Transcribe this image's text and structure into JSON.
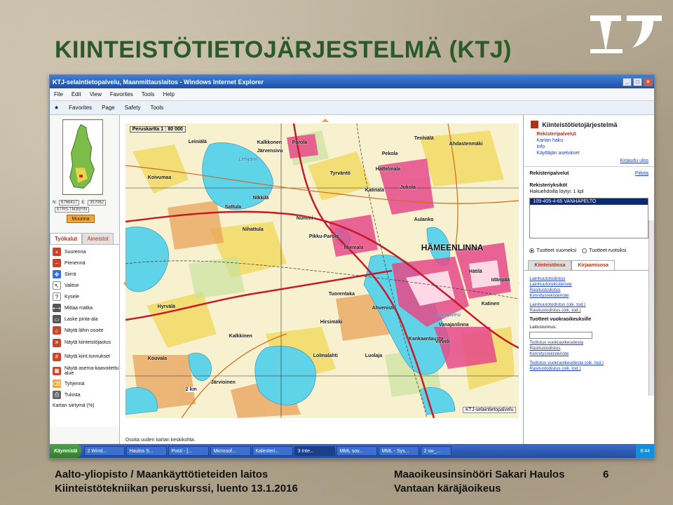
{
  "slide": {
    "title": "KIINTEISTÖTIETOJÄRJESTELMÄ (KTJ)",
    "footer_left_1": "Aalto-yliopisto / Maankäyttötieteiden laitos",
    "footer_left_2": "Kiinteistötekniikan peruskurssi, luento 13.1.2016",
    "footer_right_1": "Maaoikeusinsinööri Sakari Haulos",
    "footer_right_2": "Vantaan käräjäoikeus",
    "page_number": "6"
  },
  "browser": {
    "title": "KTJ-selaintietopalvelu, Maanmittauslaitos - Windows Internet Explorer",
    "menu": [
      "File",
      "Edit",
      "View",
      "Favorites",
      "Tools",
      "Help"
    ],
    "commands": [
      "Favorites",
      "Page",
      "Safety",
      "Tools"
    ]
  },
  "left_panel": {
    "n_label": "N:",
    "n_value": "6766417",
    "e_label": "E:",
    "e_value": "357062",
    "crs": "ETRS-TM35FIN",
    "convert_button": "Muunna",
    "tab_tools": "Työkalut",
    "tab_materials": "Aineistot",
    "tools": [
      "Suurenna",
      "Pienennä",
      "Siirrä",
      "Valitse",
      "Kysele",
      "Mittaa matka",
      "Laske pinta-ala",
      "Näytä lähin osoite",
      "Näytä kiinteistöjaotus",
      "Näytä kiint.tunnukset",
      "Näytä asema-kaavoitettu alue",
      "Tyhjennä",
      "Tulosta"
    ],
    "map_move": "Kartan siirtymä (%)"
  },
  "map": {
    "scale": "Peruskartta 1 : 80 000",
    "status": "Osoita uuden kartan keskikohta.",
    "ktj_label": "KTJ-selaintietopalvelu",
    "scale_bar": "2 km",
    "city": "HÄMEENLINNA",
    "labels": [
      "Leiniälä",
      "Kalkkonen",
      "Järvensivu",
      "Parola",
      "Pekola",
      "Lehijärvi",
      "Koivumaa",
      "Sattula",
      "Nikkilä",
      "Katinala",
      "Aulanko",
      "Nummi",
      "Nihattula",
      "Pikku-Parola",
      "Miemala",
      "Hattelmala",
      "Ahvenisto",
      "Vanajavesi",
      "Hirsimäki",
      "Kankaantausta",
      "Lolmalahti",
      "Luolaja",
      "Järvioinen",
      "Kouvala",
      "Hyrvälä",
      "Kalkkinen",
      "Tenhiälä",
      "Tuorentaka",
      "Katinen",
      "Idänpää",
      "Jukola",
      "Virveli",
      "Tyrväntö",
      "Ahdastenmäki",
      "Hätilä",
      "Vanajanlinna"
    ]
  },
  "right_panel": {
    "app_title": "Kiinteistötietojärjestelmä",
    "links": [
      "Rekisteripalvelut",
      "Kartan haku",
      "Info",
      "Käyttäjän asetukset"
    ],
    "logout": "Kirjaudu ulos",
    "section": "Rekisteripalvelut",
    "hide": "Piilota",
    "units_title": "Rekisteriyksiköt",
    "found": "Hakuehdoilla löytyi: 1 kpl",
    "result": "109-405-4-65   VANHAPELTO",
    "radio_fi": "Tuotteet suomeksi",
    "radio_sv": "Tuotteet ruotsiksi",
    "tab_property": "Kiinteistöosa",
    "tab_registration": "Kirjaamisosa",
    "docs_1": [
      "Lainhuutotodistus",
      "Lainhuutorekisteriote",
      "Rasitustodistus",
      "Kiinnitysrekisteriote"
    ],
    "docs_2": [
      "Lainhuutotodistus (oik. tod.)",
      "Rasitustodistus (oik. tod.)"
    ],
    "lease_title": "Tuotteet vuokraoikeuksille",
    "lease_id": "Laitostunnus:",
    "docs_3": [
      "Todistus vuokraoikeudesta",
      "Rasitustodistus",
      "Kiinnitysrekisteriote"
    ],
    "docs_4": [
      "Todistus vuokraoikeudesta (oik. tod.)",
      "Rasitustodistus (oik. tod.)"
    ]
  },
  "taskbar": {
    "start": "Käynnistä",
    "items": [
      "2 Wind...",
      "Haulos S...",
      "Posti - [...",
      "Microsof...",
      "Kalenteri...",
      "3 Inte...",
      "MML sov...",
      "MML - Sys...",
      "2 sw_..."
    ],
    "time": "8:44"
  },
  "colors": {
    "title_green": "#2a5a2a",
    "accent_red": "#b0321a",
    "link_blue": "#1a3fb0",
    "urban_pink": "#e64a8a",
    "lake_cyan": "#5fd3e8",
    "field_yellow": "#f2dc6a"
  }
}
